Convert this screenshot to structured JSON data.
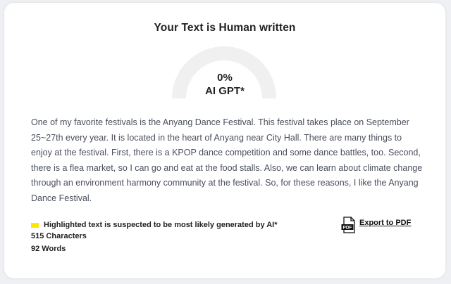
{
  "result": {
    "title": "Your Text is Human written",
    "percent": "0%",
    "percent_value": 0,
    "label": "AI GPT*"
  },
  "text_body": "One of my favorite festivals is the Anyang Dance Festival. This festival takes place on September 25~27th every year. It is located in the heart of Anyang near City Hall. There are many things to enjoy at the festival. First, there is a KPOP dance competition and some dance battles, too. Second, there is a flea market, so I can go and eat at the food stalls. Also, we can learn about climate change through an environment harmony community at the festival. So, for these reasons, I like the Anyang Dance Festival.",
  "legend": {
    "text": "Highlighted text is suspected to be most likely generated by AI*",
    "highlight_color": "#ffe600"
  },
  "stats": {
    "characters": "515 Characters",
    "words": "92 Words"
  },
  "export": {
    "label": "Export to PDF",
    "icon": "pdf-icon",
    "icon_text": "PDF"
  },
  "colors": {
    "gauge_track": "#f0f0f0",
    "gauge_fill": "#e53935",
    "body_text": "#4a4f5c"
  }
}
